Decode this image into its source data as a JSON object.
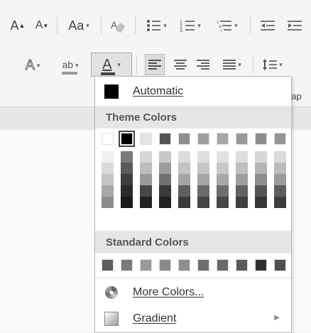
{
  "ribbon": {
    "grow_font": "A",
    "shrink_font": "A",
    "change_case": "Aa",
    "text_effects": "A",
    "highlight": "ab",
    "font_color": "A",
    "paragraph_label_partial": "rap"
  },
  "menu": {
    "automatic_label": "Automatic",
    "theme_colors_header": "Theme Colors",
    "standard_colors_header": "Standard Colors",
    "more_colors_label": "More Colors...",
    "gradient_label": "Gradient"
  },
  "theme_top_row": [
    "#ffffff",
    "#000000",
    "#e4e4e4",
    "#555555",
    "#8f8f8f",
    "#9e9e9e",
    "#a6a6a6",
    "#9a9a9a",
    "#8c8c8c",
    "#949494"
  ],
  "theme_columns": [
    [
      "#f0f0f0",
      "#dadada",
      "#c4c4c4",
      "#a8a8a8",
      "#8c8c8c"
    ],
    [
      "#7a7a7a",
      "#5a5a5a",
      "#3e3e3e",
      "#2a2a2a",
      "#191919"
    ],
    [
      "#d6d6d6",
      "#bbbbbb",
      "#9a9a9a",
      "#474747",
      "#222222"
    ],
    [
      "#c8c8c8",
      "#9c9c9c",
      "#707070",
      "#3a3a3a",
      "#202020"
    ],
    [
      "#dcdcdc",
      "#c4c4c4",
      "#a4a4a4",
      "#606060",
      "#3a3a3a"
    ],
    [
      "#e0e0e0",
      "#c6c6c6",
      "#a6a6a6",
      "#6a6a6a",
      "#454545"
    ],
    [
      "#e2e2e2",
      "#c8c8c8",
      "#a8a8a8",
      "#6e6e6e",
      "#474747"
    ],
    [
      "#dedede",
      "#bfbfbf",
      "#9e9e9e",
      "#626262",
      "#3e3e3e"
    ],
    [
      "#d6d6d6",
      "#b4b4b4",
      "#8e8e8e",
      "#555555",
      "#363636"
    ],
    [
      "#dadada",
      "#bcbcbc",
      "#9a9a9a",
      "#5e5e5e",
      "#3c3c3c"
    ]
  ],
  "standard_colors": [
    "#5e5e5e",
    "#7a7a7a",
    "#9a9a9a",
    "#8a8a8a",
    "#8e8e8e",
    "#6e6e6e",
    "#6a6a6a",
    "#5a5a5a",
    "#2e2e2e",
    "#4e4e4e"
  ]
}
